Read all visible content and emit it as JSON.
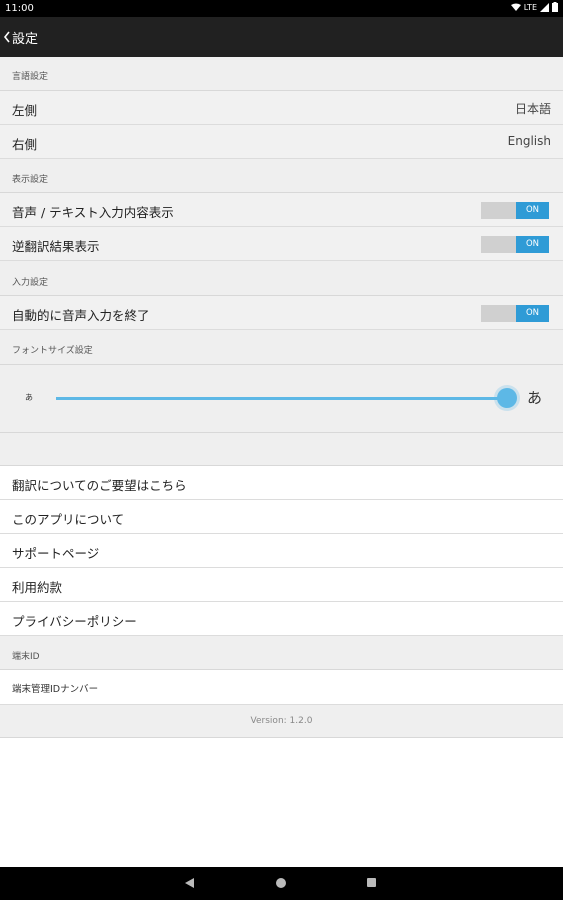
{
  "status_bar": {
    "time": "11:00",
    "network": "LTE"
  },
  "header": {
    "title": "設定"
  },
  "language_settings": {
    "section_label": "言語設定",
    "left": {
      "label": "左側",
      "value": "日本語"
    },
    "right": {
      "label": "右側",
      "value": "English"
    }
  },
  "display_settings": {
    "section_label": "表示設定",
    "voice_text_display": {
      "label": "音声 / テキスト入力内容表示",
      "state": "ON"
    },
    "back_translation_display": {
      "label": "逆翻訳結果表示",
      "state": "ON"
    }
  },
  "input_settings": {
    "section_label": "入力設定",
    "auto_end_voice_input": {
      "label": "自動的に音声入力を終了",
      "state": "ON"
    }
  },
  "font_size_settings": {
    "section_label": "フォントサイズ設定",
    "small_label": "あ",
    "large_label": "あ",
    "level": 1.0
  },
  "menu_items": [
    {
      "label": "翻訳についてのご要望はこちら"
    },
    {
      "label": "このアプリについて"
    },
    {
      "label": "サポートページ"
    },
    {
      "label": "利用約款"
    },
    {
      "label": "プライバシーポリシー"
    }
  ],
  "device_id": {
    "section_label": "端末ID",
    "label": "端末管理IDナンバー"
  },
  "version_text": "Version: 1.2.0",
  "colors": {
    "accent": "#2f9bd6",
    "appbar": "#212121",
    "section_bg": "#efefef"
  }
}
